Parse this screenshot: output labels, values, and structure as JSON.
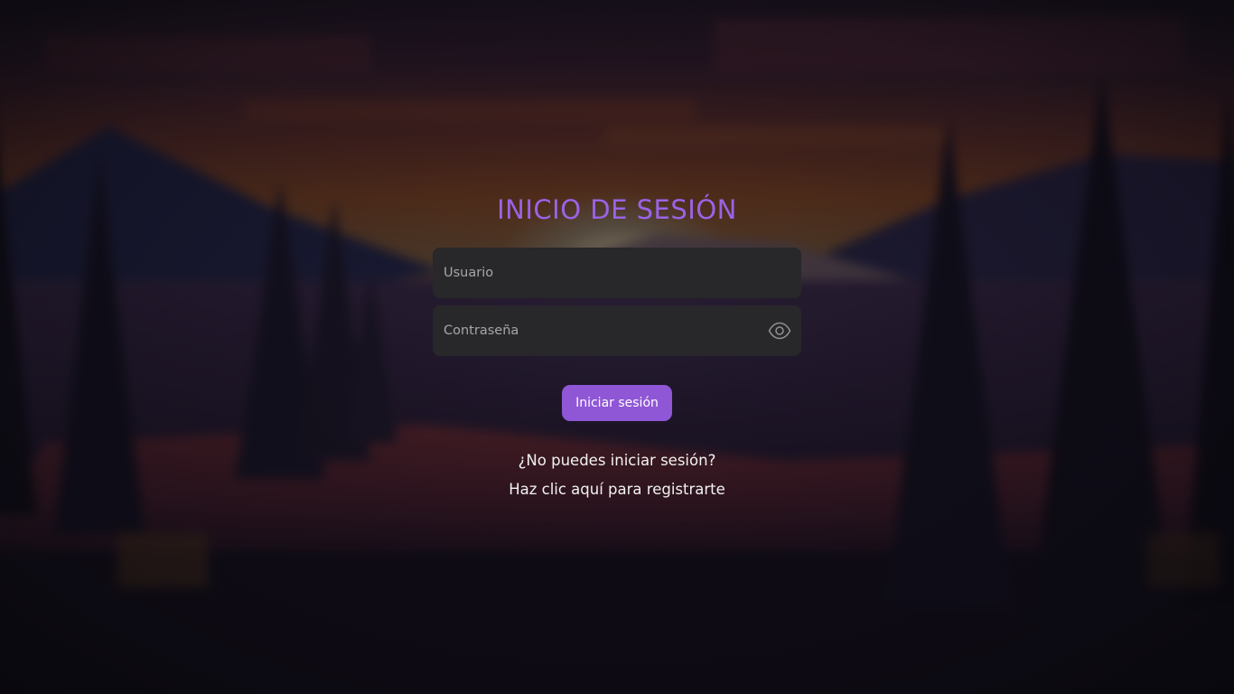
{
  "login": {
    "title": "INICIO DE SESIÓN",
    "username_placeholder": "Usuario",
    "password_placeholder": "Contraseña",
    "submit_label": "Iniciar sesión",
    "forgot_label": "¿No puedes iniciar sesión?",
    "register_label": "Haz clic aquí para registrarte",
    "password_toggle_icon": "eye-icon"
  },
  "colors": {
    "accent": "#8f56d6",
    "title": "#9b63e6",
    "input_bg": "#28272a",
    "placeholder": "#a6a6aa",
    "link_text": "#f2f2f2"
  }
}
